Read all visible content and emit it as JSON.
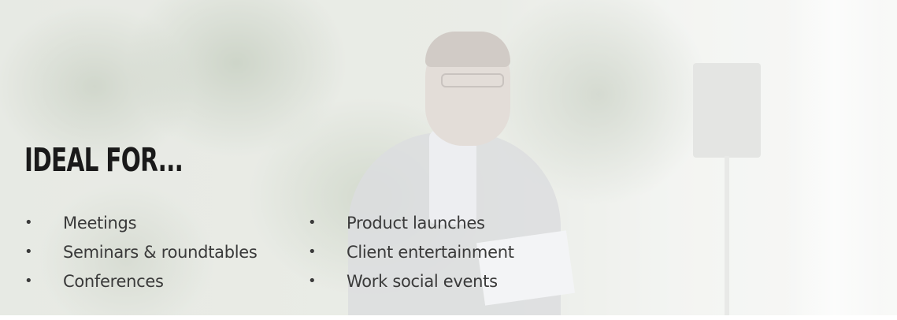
{
  "banner": {
    "heading": "IDEAL FOR...",
    "bullet_glyph": "•",
    "column_left": [
      {
        "label": "Meetings"
      },
      {
        "label": "Seminars & roundtables"
      },
      {
        "label": "Conferences"
      }
    ],
    "column_right": [
      {
        "label": "Product launches"
      },
      {
        "label": "Client entertainment"
      },
      {
        "label": "Work social events"
      }
    ]
  },
  "colors": {
    "heading": "#1a1a1a",
    "body_text": "#3a3a3a",
    "background_tint": "#e9ebe6"
  }
}
